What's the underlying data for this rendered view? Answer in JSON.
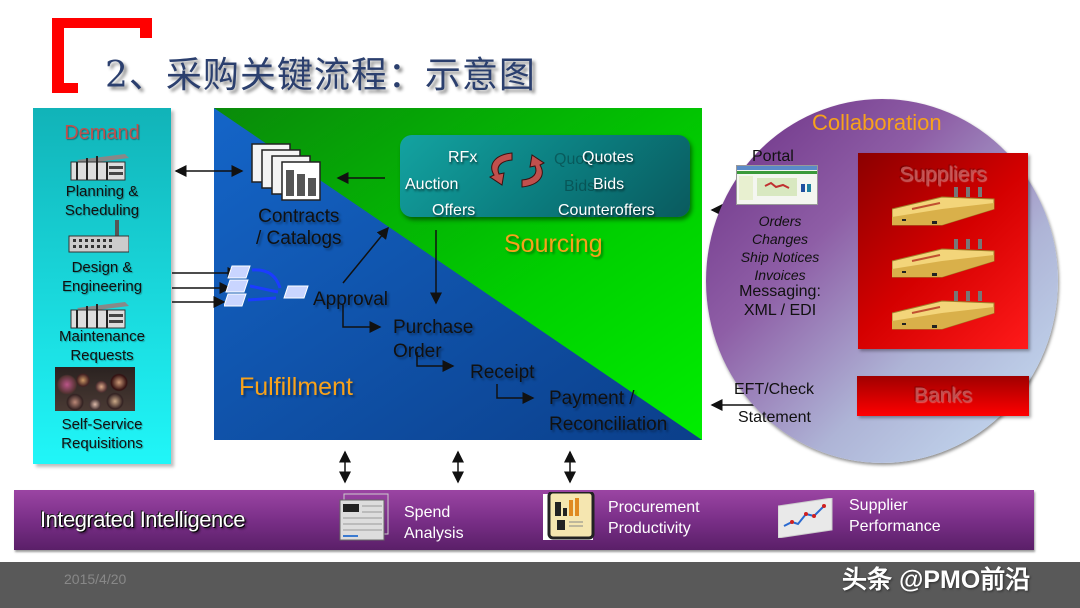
{
  "title": "2、采购关键流程：示意图",
  "demand": {
    "title": "Demand",
    "items": [
      {
        "label": "Planning &\nScheduling",
        "icon": "office-building-icon"
      },
      {
        "label": "Design &\nEngineering",
        "icon": "factory-icon"
      },
      {
        "label": "Maintenance\nRequests",
        "icon": "office-building-icon"
      },
      {
        "label": "Self-Service\nRequisitions",
        "icon": "crowd-photo"
      }
    ]
  },
  "sourcing": {
    "section_label": "Sourcing",
    "left_items": [
      "RFx",
      "Auction",
      "Offers"
    ],
    "right_items": [
      "Quotes",
      "Bids",
      "Counteroffers"
    ],
    "ghost_items": [
      "Quotes",
      "Bids"
    ]
  },
  "fulfillment": {
    "section_label": "Fulfillment",
    "contracts_label": "Contracts\n/ Catalogs",
    "steps": [
      "Approval",
      "Purchase\nOrder",
      "Receipt",
      "Payment /\nReconciliation"
    ]
  },
  "collaboration": {
    "title": "Collaboration",
    "portal_label": "Portal",
    "documents": [
      "Orders",
      "Changes",
      "Ship Notices",
      "Invoices"
    ],
    "messaging_label": "Messaging:\nXML / EDI",
    "payment_top": "EFT/Check",
    "payment_bottom": "Statement",
    "suppliers_label": "Suppliers",
    "banks_label": "Banks"
  },
  "intelligence": {
    "title": "Integrated Intelligence",
    "items": [
      {
        "label": "Spend\nAnalysis",
        "icon": "spreadsheet-icon"
      },
      {
        "label": "Procurement\nProductivity",
        "icon": "report-chart-icon"
      },
      {
        "label": "Supplier\nPerformance",
        "icon": "line-chart-icon"
      }
    ]
  },
  "footer": {
    "date": "2015/4/20",
    "brand": "头条 @PMO前沿"
  },
  "colors": {
    "accent_red": "#ff0000",
    "demand_cyan": "#19d6da",
    "fulfillment_blue": "#1160b8",
    "sourcing_green": "#00dd00",
    "section_orange": "#f7a21b",
    "intelligence_purple": "#7a2f88",
    "footer_gray": "#595959"
  }
}
